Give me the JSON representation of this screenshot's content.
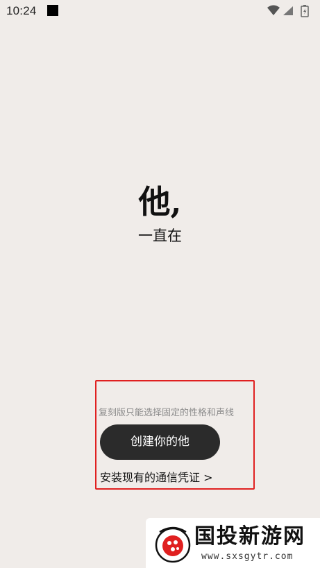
{
  "status_bar": {
    "time": "10:24",
    "icons": [
      "notification-square-icon",
      "wifi-icon",
      "signal-icon",
      "battery-icon"
    ]
  },
  "hero": {
    "title": "他,",
    "subtitle": "一直在"
  },
  "highlighted_section": {
    "note": "复刻版只能选择固定的性格和声线",
    "create_button_label": "创建你的他",
    "install_link_label": "安装现有的通信凭证 >"
  },
  "watermark": {
    "name": "国投新游网",
    "url": "www.sxsgytr.com"
  },
  "colors": {
    "background": "#f0ece9",
    "button": "#2b2b2b",
    "highlight_border": "#e02020",
    "watermark_accent": "#e02020"
  }
}
